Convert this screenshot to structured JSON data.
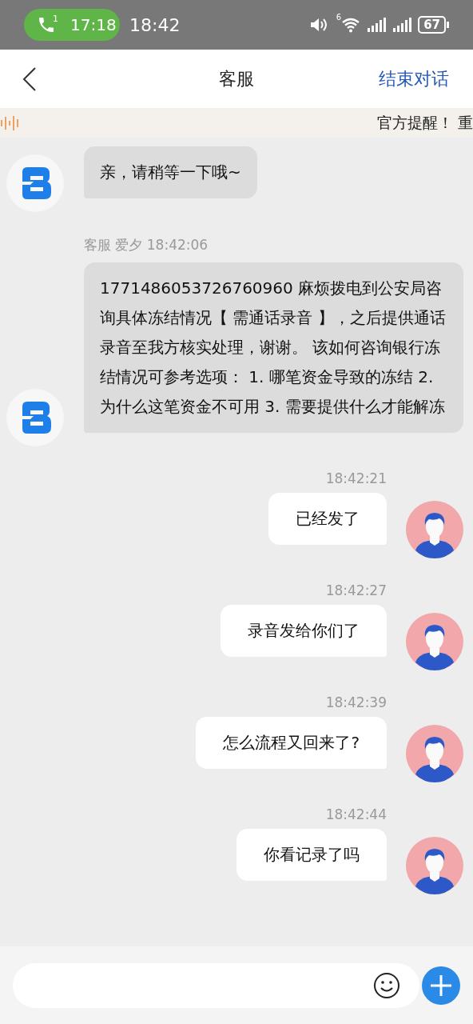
{
  "status_bar": {
    "call_badge": "1",
    "call_time": "17:18",
    "time": "18:42",
    "wifi_label": "6",
    "battery": "67"
  },
  "header": {
    "title": "客服",
    "end_button": "结束对话"
  },
  "notice": {
    "text": "官方提醒！ 重"
  },
  "messages": [
    {
      "kind": "agent",
      "text": "亲，请稍等一下哦~"
    },
    {
      "kind": "agent",
      "meta": "客服 爱夕 18:42:06",
      "text": "1771486053726760960 麻烦拨电到公安局咨询具体冻结情况【 需通话录音 】，之后提供通话录音至我方核实处理，谢谢。 该如何咨询银行冻结情况可参考选项：  1. 哪笔资金导致的冻结 2. 为什么这笔资金不可用 3. 需要提供什么才能解冻"
    },
    {
      "kind": "user",
      "time": "18:42:21",
      "text": "已经发了"
    },
    {
      "kind": "user",
      "time": "18:42:27",
      "text": "录音发给你们了"
    },
    {
      "kind": "user",
      "time": "18:42:39",
      "text": "怎么流程又回来了?"
    },
    {
      "kind": "user",
      "time": "18:42:44",
      "text": "你看记录了吗"
    }
  ]
}
